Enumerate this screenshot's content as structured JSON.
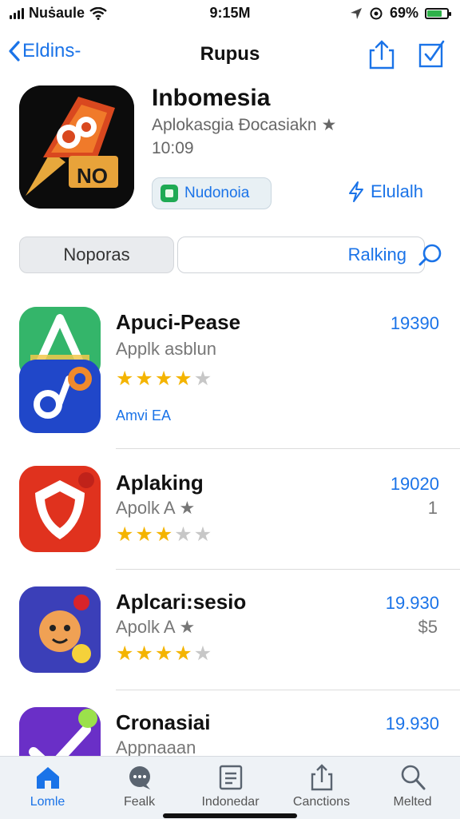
{
  "status_bar": {
    "carrier": "Nuṡaule",
    "time": "9:15M",
    "battery": "69%",
    "battery_level": 0.69
  },
  "nav": {
    "back_label": "Eldins-",
    "title": "Rupus"
  },
  "app": {
    "name": "Inbomesia",
    "subtitle": "Aplokasgia Ðocasiakn ★",
    "time": "10:09",
    "get_label": "Nudonoia",
    "share_label": "Elulalh"
  },
  "segments": {
    "left": "Noporas",
    "right": "Ralking"
  },
  "list": [
    {
      "title": "Apuci-Pease",
      "subtitle": "Applk asblun",
      "price": "19390",
      "extra": "",
      "rating": 4,
      "meta": "Amvi EA"
    },
    {
      "title": "Aplaking",
      "subtitle": "Apolk A ★",
      "price": "19020",
      "extra": "1",
      "rating": 3,
      "meta": ""
    },
    {
      "title": "Aplcari:sesio",
      "subtitle": "Apolk A ★",
      "price": "19.930",
      "extra": "$5",
      "rating": 4,
      "meta": ""
    },
    {
      "title": "Cronasiai",
      "subtitle": "Appnaaan",
      "price": "19.930",
      "extra": "",
      "rating": 0,
      "meta": ""
    }
  ],
  "tabs": [
    {
      "label": "Lomle",
      "icon": "home-icon",
      "active": true
    },
    {
      "label": "Fealk",
      "icon": "chat-icon",
      "active": false
    },
    {
      "label": "Indonedar",
      "icon": "document-icon",
      "active": false
    },
    {
      "label": "Canctions",
      "icon": "share-icon",
      "active": false
    },
    {
      "label": "Melted",
      "icon": "search-icon",
      "active": false
    }
  ],
  "colors": {
    "accent": "#1a73e8",
    "star": "#f4b400",
    "tabbar_bg": "#eef2f6"
  }
}
